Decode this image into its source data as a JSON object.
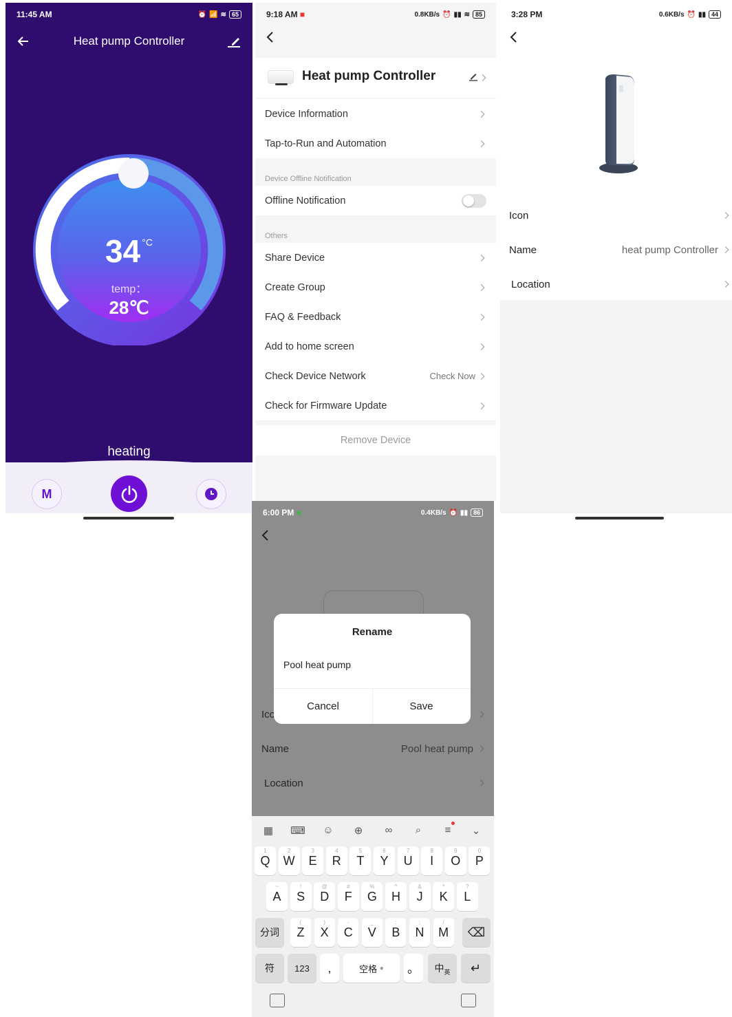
{
  "panel1": {
    "status_time": "11:45 AM",
    "battery": "65",
    "title": "Heat pump Controller",
    "temperature": "34",
    "temperature_unit": "°C",
    "temp_label": "temp：",
    "set_temp": "28℃",
    "mode_text": "heating",
    "mode_button": "M",
    "accent": "#6f0fd6",
    "background": "#2e0d6e",
    "dial_level_fraction": 0.38
  },
  "panel2": {
    "status_time": "9:18 AM",
    "net_speed": "0.8KB/s",
    "battery": "85",
    "device_name": "Heat pump Controller",
    "rows_top": [
      {
        "label": "Device Information"
      },
      {
        "label": "Tap-to-Run and Automation"
      }
    ],
    "section_offline": "Device Offline Notification",
    "offline_label": "Offline Notification",
    "offline_enabled": false,
    "section_others": "Others",
    "rows_others": [
      {
        "label": "Share Device"
      },
      {
        "label": "Create Group"
      },
      {
        "label": "FAQ & Feedback"
      },
      {
        "label": "Add to home screen"
      },
      {
        "label": "Check Device Network",
        "right": "Check Now"
      },
      {
        "label": "Check for Firmware Update"
      }
    ],
    "remove_label": "Remove Device"
  },
  "panel3": {
    "status_time": "3:28 PM",
    "net_speed": "0.6KB/s",
    "battery": "44",
    "rows": [
      {
        "label": "Icon",
        "value": ""
      },
      {
        "label": "Name",
        "value": "heat pump Controller"
      },
      {
        "label": "Location",
        "value": ""
      }
    ]
  },
  "panel4": {
    "status_time": "6:00 PM",
    "net_speed": "0.4KB/s",
    "battery": "86",
    "dialog": {
      "title": "Rename",
      "input_value": "Pool heat pump",
      "cancel": "Cancel",
      "save": "Save"
    },
    "rows": [
      {
        "label": "Icc",
        "value": ""
      },
      {
        "label": "Name",
        "value": "Pool heat pump"
      },
      {
        "label": "Location",
        "value": ""
      }
    ],
    "keyboard": {
      "row1": [
        {
          "k": "Q",
          "n": "1"
        },
        {
          "k": "W",
          "n": "2"
        },
        {
          "k": "E",
          "n": "3"
        },
        {
          "k": "R",
          "n": "4"
        },
        {
          "k": "T",
          "n": "5"
        },
        {
          "k": "Y",
          "n": "6"
        },
        {
          "k": "U",
          "n": "7"
        },
        {
          "k": "I",
          "n": "8"
        },
        {
          "k": "O",
          "n": "9"
        },
        {
          "k": "P",
          "n": "0"
        }
      ],
      "row2": [
        {
          "k": "A",
          "n": "~"
        },
        {
          "k": "S",
          "n": "!"
        },
        {
          "k": "D",
          "n": "@"
        },
        {
          "k": "F",
          "n": "#"
        },
        {
          "k": "G",
          "n": "%"
        },
        {
          "k": "H",
          "n": "^"
        },
        {
          "k": "J",
          "n": "&"
        },
        {
          "k": "K",
          "n": "*"
        },
        {
          "k": "L",
          "n": "?"
        }
      ],
      "row3": [
        {
          "k": "Z",
          "n": "("
        },
        {
          "k": "X",
          "n": ")"
        },
        {
          "k": "C",
          "n": "-"
        },
        {
          "k": "V",
          "n": "_"
        },
        {
          "k": "B",
          "n": ":"
        },
        {
          "k": "N",
          "n": ";"
        },
        {
          "k": "M",
          "n": "/"
        }
      ],
      "fenci": "分词",
      "symbols": "符",
      "numbers": "123",
      "comma": ",",
      "space": "空格",
      "period": "。",
      "lang": "中",
      "lang_sub": "英"
    }
  }
}
